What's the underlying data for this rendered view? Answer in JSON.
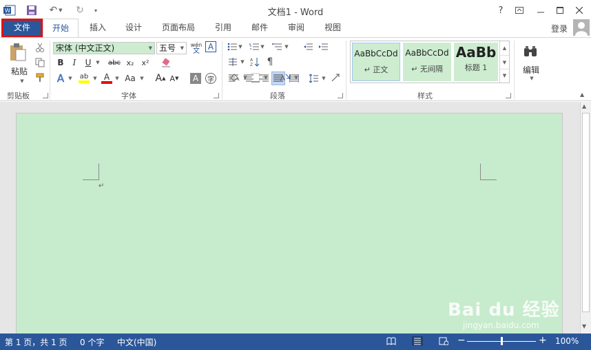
{
  "window": {
    "title": "文档1 - Word",
    "help": "?",
    "login": "登录"
  },
  "tabs": [
    {
      "label": "文件"
    },
    {
      "label": "开始"
    },
    {
      "label": "插入"
    },
    {
      "label": "设计"
    },
    {
      "label": "页面布局"
    },
    {
      "label": "引用"
    },
    {
      "label": "邮件"
    },
    {
      "label": "审阅"
    },
    {
      "label": "视图"
    }
  ],
  "ribbon": {
    "clipboard": {
      "label": "剪贴板",
      "paste_label": "粘贴"
    },
    "font": {
      "label": "字体",
      "font_name": "宋体 (中文正文)",
      "font_size": "五号",
      "bold": "B",
      "italic": "I",
      "underline": "U",
      "strike": "abc",
      "subscript": "x₂",
      "superscript": "x²",
      "change_case": "Aa",
      "grow": "A",
      "shrink": "A",
      "phonetic": "wén",
      "border_char": "A",
      "shade_char": "A",
      "enclose_char": "字",
      "text_effect": "A",
      "highlight": "ab",
      "font_color": "A"
    },
    "paragraph": {
      "label": "段落"
    },
    "styles": {
      "label": "样式",
      "items": [
        {
          "sample": "AaBbCcDd",
          "name": "↵ 正文"
        },
        {
          "sample": "AaBbCcDd",
          "name": "↵ 无间隔"
        },
        {
          "sample": "AaBb",
          "name": "标题 1"
        }
      ]
    },
    "editing": {
      "label": "编辑"
    }
  },
  "document": {
    "paragraph_mark": "↵"
  },
  "status": {
    "page": "第 1 页，共 1 页",
    "words": "0 个字",
    "language": "中文(中国)",
    "zoom": "100%",
    "zoom_minus": "−",
    "zoom_plus": "+"
  },
  "watermark": {
    "brand": "Bai du 经验",
    "url": "jingyan.baidu.com"
  },
  "colors": {
    "accent": "#2b579a",
    "page": "#c7ebcd",
    "highlight_marker": "#e01010"
  }
}
